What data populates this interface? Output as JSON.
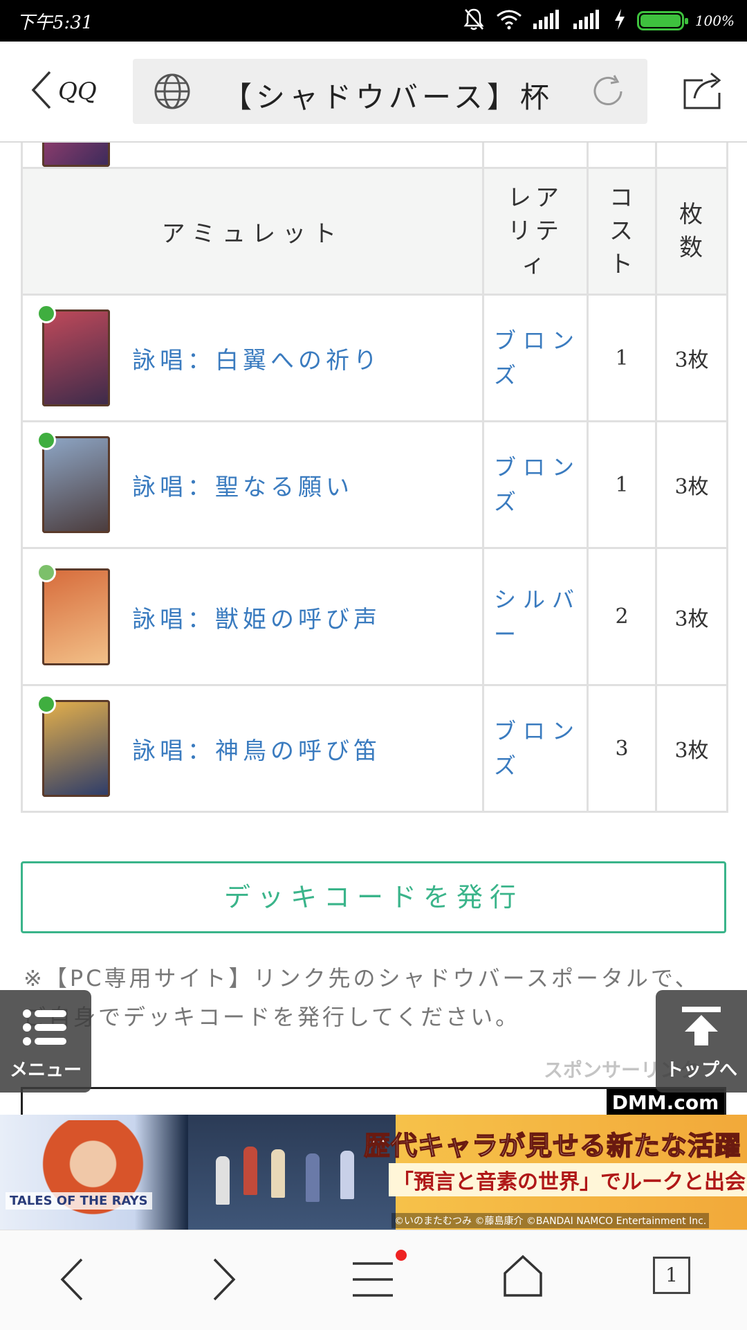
{
  "status_bar": {
    "time": "下午5:31",
    "battery_percent": "100%",
    "battery_level": 1.0
  },
  "browser": {
    "back_label": "QQ",
    "page_title": "【シャドウバース】杯",
    "tab_count": "1"
  },
  "table": {
    "headers": {
      "amulet": "アミュレット",
      "rarity": "レアリティ",
      "cost": "コスト",
      "count": "枚数"
    },
    "rows": [
      {
        "name": "詠唱：白翼への祈り",
        "rarity": "ブロンズ",
        "cost": "1",
        "count": "3枚",
        "gem_color": "#3fae3f",
        "art_colors": [
          "#c24a5a",
          "#3a2a4a"
        ]
      },
      {
        "name": "詠唱：聖なる願い",
        "rarity": "ブロンズ",
        "cost": "1",
        "count": "3枚",
        "gem_color": "#3fae3f",
        "art_colors": [
          "#8fa8c8",
          "#4a3a3a"
        ]
      },
      {
        "name": "詠唱：獣姫の呼び声",
        "rarity": "シルバー",
        "cost": "2",
        "count": "3枚",
        "gem_color": "#7cc06a",
        "art_colors": [
          "#d66a3a",
          "#f3c28a"
        ]
      },
      {
        "name": "詠唱：神鳥の呼び笛",
        "rarity": "ブロンズ",
        "cost": "3",
        "count": "3枚",
        "gem_color": "#3fae3f",
        "art_colors": [
          "#e8b24a",
          "#2a3a6a"
        ]
      }
    ]
  },
  "deck_button": "デッキコードを発行",
  "note": "※【PC専用サイト】リンク先のシャドウバースポータルで、ご自身でデッキコードを発行してください。",
  "floating": {
    "menu": "メニュー",
    "top": "トップへ"
  },
  "sponsor_label": "スポンサーリンク",
  "ad": {
    "brand": "DMM.com",
    "game_logo": "TALES OF THE RAYS",
    "headline": "歴代キャラが見せる新たな活躍",
    "subline": "「預言と音素の世界」でルークと出会う!",
    "copyright": "©いのまたむつみ ©藤島康介 ©BANDAI NAMCO Entertainment Inc."
  },
  "colors": {
    "link": "#3a7bbf",
    "accent": "#3ab48a",
    "header_bg": "#f4f5f4"
  }
}
